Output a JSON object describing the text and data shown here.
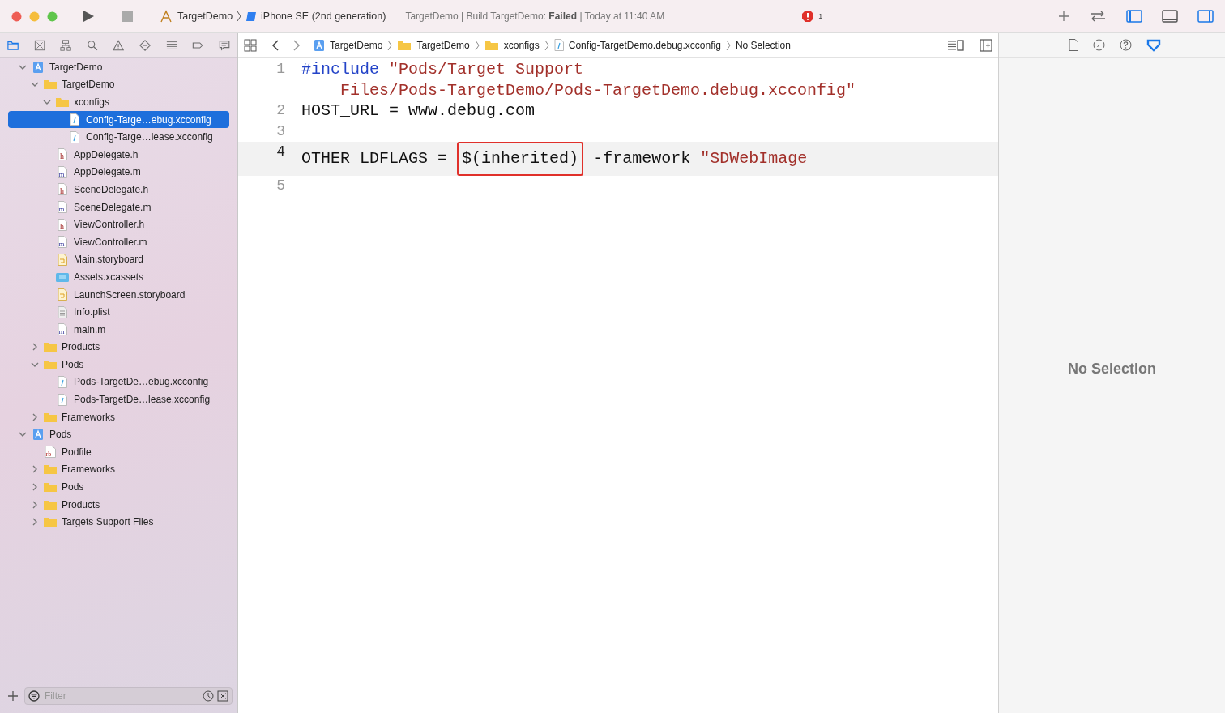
{
  "toolbar": {
    "scheme": "TargetDemo",
    "device": "iPhone SE (2nd generation)",
    "status": "TargetDemo | Build TargetDemo: **Failed** | Today at 11:40 AM",
    "error_count": "1"
  },
  "navigator_tabs": [
    {
      "kind": "folder",
      "selected": true
    },
    {
      "kind": "xbox",
      "selected": false
    },
    {
      "kind": "hierarchy",
      "selected": false
    },
    {
      "kind": "search",
      "selected": false
    },
    {
      "kind": "warning",
      "selected": false
    },
    {
      "kind": "diamond",
      "selected": false
    },
    {
      "kind": "list",
      "selected": false
    },
    {
      "kind": "tag",
      "selected": false
    },
    {
      "kind": "bubble",
      "selected": false
    }
  ],
  "tree": [
    {
      "label": "TargetDemo",
      "kind": "project",
      "expanded": true,
      "selected": false,
      "children": [
        {
          "label": "TargetDemo",
          "kind": "folder",
          "expanded": true,
          "selected": false,
          "children": [
            {
              "label": "xconfigs",
              "kind": "folder",
              "expanded": true,
              "selected": false,
              "children": [
                {
                  "label": "Config-Targe…ebug.xcconfig",
                  "kind": "config",
                  "selected": true
                },
                {
                  "label": "Config-Targe…lease.xcconfig",
                  "kind": "config",
                  "selected": false
                }
              ]
            },
            {
              "label": "AppDelegate.h",
              "kind": "h",
              "selected": false
            },
            {
              "label": "AppDelegate.m",
              "kind": "m",
              "selected": false
            },
            {
              "label": "SceneDelegate.h",
              "kind": "h",
              "selected": false
            },
            {
              "label": "SceneDelegate.m",
              "kind": "m",
              "selected": false
            },
            {
              "label": "ViewController.h",
              "kind": "h",
              "selected": false
            },
            {
              "label": "ViewController.m",
              "kind": "m",
              "selected": false
            },
            {
              "label": "Main.storyboard",
              "kind": "storyboard",
              "selected": false
            },
            {
              "label": "Assets.xcassets",
              "kind": "assets",
              "selected": false
            },
            {
              "label": "LaunchScreen.storyboard",
              "kind": "storyboard",
              "selected": false
            },
            {
              "label": "Info.plist",
              "kind": "plist",
              "selected": false
            },
            {
              "label": "main.m",
              "kind": "m",
              "selected": false
            }
          ]
        },
        {
          "label": "Products",
          "kind": "folder",
          "expanded": false,
          "selected": false
        },
        {
          "label": "Pods",
          "kind": "folder",
          "expanded": true,
          "selected": false,
          "children": [
            {
              "label": "Pods-TargetDe…ebug.xcconfig",
              "kind": "config",
              "selected": false
            },
            {
              "label": "Pods-TargetDe…lease.xcconfig",
              "kind": "config",
              "selected": false
            }
          ]
        },
        {
          "label": "Frameworks",
          "kind": "folder",
          "expanded": false,
          "selected": false
        }
      ]
    },
    {
      "label": "Pods",
      "kind": "project",
      "expanded": true,
      "selected": false,
      "children": [
        {
          "label": "Podfile",
          "kind": "rb",
          "selected": false
        },
        {
          "label": "Frameworks",
          "kind": "folder",
          "expanded": false,
          "selected": false
        },
        {
          "label": "Pods",
          "kind": "folder",
          "expanded": false,
          "selected": false
        },
        {
          "label": "Products",
          "kind": "folder",
          "expanded": false,
          "selected": false
        },
        {
          "label": "Targets Support Files",
          "kind": "folder",
          "expanded": false,
          "selected": false
        }
      ]
    }
  ],
  "filter": {
    "placeholder": "Filter"
  },
  "breadcrumb": [
    {
      "label": "TargetDemo",
      "kind": "project"
    },
    {
      "label": "TargetDemo",
      "kind": "folder"
    },
    {
      "label": "xconfigs",
      "kind": "folder"
    },
    {
      "label": "Config-TargetDemo.debug.xcconfig",
      "kind": "config"
    },
    {
      "label": "No Selection",
      "kind": "plain"
    }
  ],
  "code_lines": [
    {
      "number": "1",
      "current": false,
      "tokens": [
        {
          "text": "#include",
          "kind": "keyword",
          "boxed": false
        },
        {
          "text": " \"Pods/Target Support Files/Pods-TargetDemo/Pods-TargetDemo.debug.xcconfig\"",
          "kind": "string",
          "boxed": false
        }
      ]
    },
    {
      "number": "2",
      "current": false,
      "tokens": [
        {
          "text": "HOST_URL = www.debug.com",
          "kind": "plain",
          "boxed": false
        }
      ]
    },
    {
      "number": "3",
      "current": false
    },
    {
      "number": "4",
      "current": true,
      "tokens": [
        {
          "text": "OTHER_LDFLAGS =",
          "kind": "plain",
          "boxed": false
        },
        {
          "text": "$(inherited)",
          "kind": "plain",
          "boxed": true
        },
        {
          "text": "-framework",
          "kind": "plain",
          "boxed": false
        },
        {
          "text": "\"SDWebImage",
          "kind": "string",
          "boxed": false
        }
      ]
    },
    {
      "number": "5",
      "current": false
    }
  ],
  "inspector": {
    "message": "No Selection"
  }
}
